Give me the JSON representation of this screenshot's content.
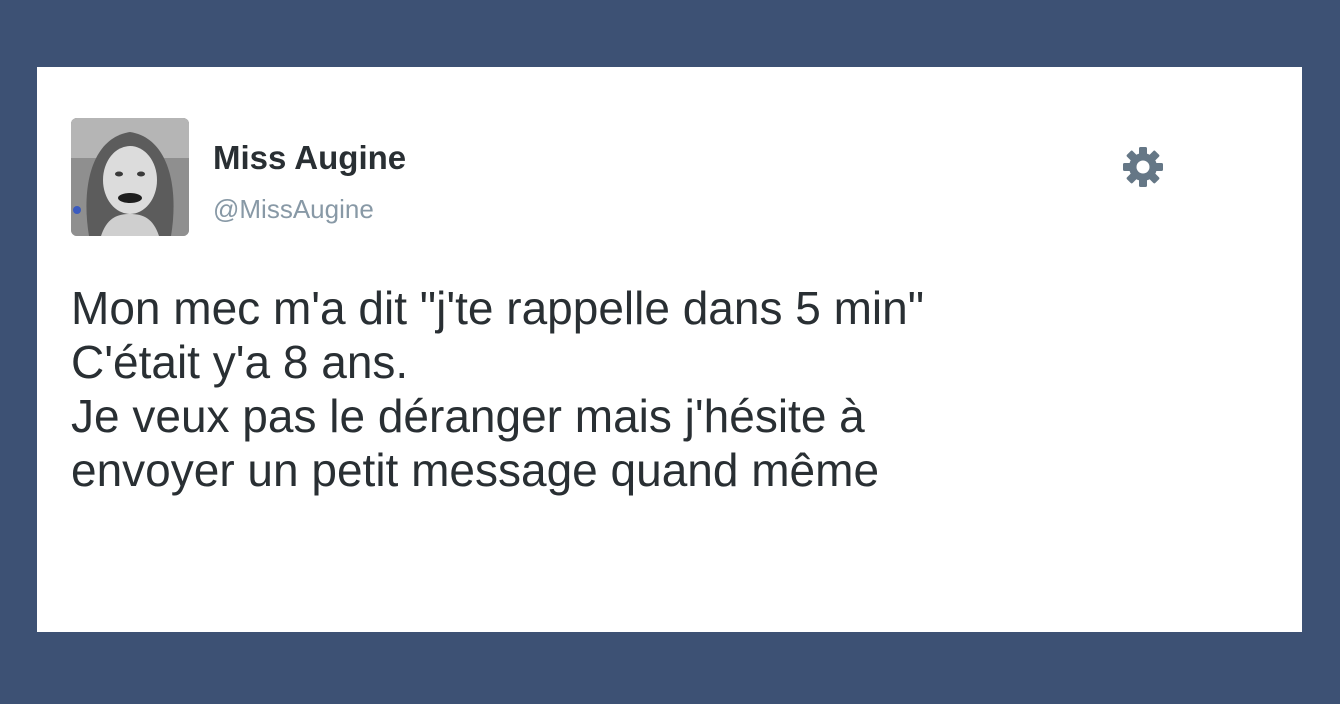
{
  "tweet": {
    "display_name": "Miss Augine",
    "handle": "@MissAugine",
    "avatar_icon": "profile-photo",
    "settings_icon": "gear-icon",
    "text_lines": [
      "Mon mec m'a dit \"j'te rappelle dans 5 min\"",
      "C'était y'a 8 ans.",
      "Je veux pas le déranger mais j'hésite à",
      "envoyer un petit message quand même"
    ]
  },
  "colors": {
    "background": "#3d5174",
    "card": "#ffffff",
    "text": "#292f33",
    "handle": "#8899a6",
    "icon": "#657786"
  }
}
